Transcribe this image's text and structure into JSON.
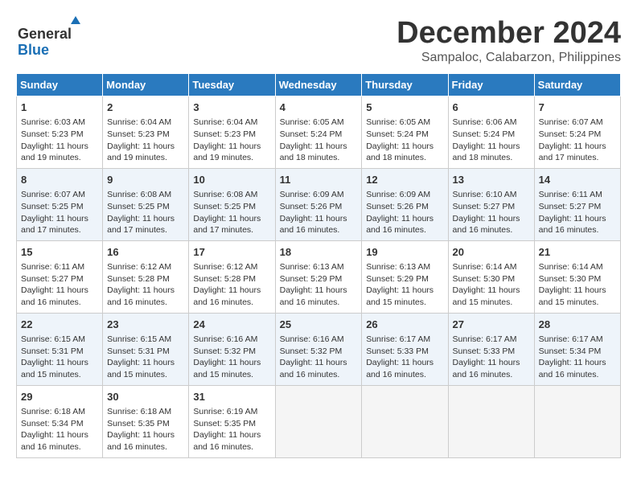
{
  "header": {
    "logo_general": "General",
    "logo_blue": "Blue",
    "title": "December 2024",
    "subtitle": "Sampaloc, Calabarzon, Philippines"
  },
  "days_of_week": [
    "Sunday",
    "Monday",
    "Tuesday",
    "Wednesday",
    "Thursday",
    "Friday",
    "Saturday"
  ],
  "weeks": [
    [
      {
        "day": "1",
        "sunrise": "Sunrise: 6:03 AM",
        "sunset": "Sunset: 5:23 PM",
        "daylight": "Daylight: 11 hours and 19 minutes."
      },
      {
        "day": "2",
        "sunrise": "Sunrise: 6:04 AM",
        "sunset": "Sunset: 5:23 PM",
        "daylight": "Daylight: 11 hours and 19 minutes."
      },
      {
        "day": "3",
        "sunrise": "Sunrise: 6:04 AM",
        "sunset": "Sunset: 5:23 PM",
        "daylight": "Daylight: 11 hours and 19 minutes."
      },
      {
        "day": "4",
        "sunrise": "Sunrise: 6:05 AM",
        "sunset": "Sunset: 5:24 PM",
        "daylight": "Daylight: 11 hours and 18 minutes."
      },
      {
        "day": "5",
        "sunrise": "Sunrise: 6:05 AM",
        "sunset": "Sunset: 5:24 PM",
        "daylight": "Daylight: 11 hours and 18 minutes."
      },
      {
        "day": "6",
        "sunrise": "Sunrise: 6:06 AM",
        "sunset": "Sunset: 5:24 PM",
        "daylight": "Daylight: 11 hours and 18 minutes."
      },
      {
        "day": "7",
        "sunrise": "Sunrise: 6:07 AM",
        "sunset": "Sunset: 5:24 PM",
        "daylight": "Daylight: 11 hours and 17 minutes."
      }
    ],
    [
      {
        "day": "8",
        "sunrise": "Sunrise: 6:07 AM",
        "sunset": "Sunset: 5:25 PM",
        "daylight": "Daylight: 11 hours and 17 minutes."
      },
      {
        "day": "9",
        "sunrise": "Sunrise: 6:08 AM",
        "sunset": "Sunset: 5:25 PM",
        "daylight": "Daylight: 11 hours and 17 minutes."
      },
      {
        "day": "10",
        "sunrise": "Sunrise: 6:08 AM",
        "sunset": "Sunset: 5:25 PM",
        "daylight": "Daylight: 11 hours and 17 minutes."
      },
      {
        "day": "11",
        "sunrise": "Sunrise: 6:09 AM",
        "sunset": "Sunset: 5:26 PM",
        "daylight": "Daylight: 11 hours and 16 minutes."
      },
      {
        "day": "12",
        "sunrise": "Sunrise: 6:09 AM",
        "sunset": "Sunset: 5:26 PM",
        "daylight": "Daylight: 11 hours and 16 minutes."
      },
      {
        "day": "13",
        "sunrise": "Sunrise: 6:10 AM",
        "sunset": "Sunset: 5:27 PM",
        "daylight": "Daylight: 11 hours and 16 minutes."
      },
      {
        "day": "14",
        "sunrise": "Sunrise: 6:11 AM",
        "sunset": "Sunset: 5:27 PM",
        "daylight": "Daylight: 11 hours and 16 minutes."
      }
    ],
    [
      {
        "day": "15",
        "sunrise": "Sunrise: 6:11 AM",
        "sunset": "Sunset: 5:27 PM",
        "daylight": "Daylight: 11 hours and 16 minutes."
      },
      {
        "day": "16",
        "sunrise": "Sunrise: 6:12 AM",
        "sunset": "Sunset: 5:28 PM",
        "daylight": "Daylight: 11 hours and 16 minutes."
      },
      {
        "day": "17",
        "sunrise": "Sunrise: 6:12 AM",
        "sunset": "Sunset: 5:28 PM",
        "daylight": "Daylight: 11 hours and 16 minutes."
      },
      {
        "day": "18",
        "sunrise": "Sunrise: 6:13 AM",
        "sunset": "Sunset: 5:29 PM",
        "daylight": "Daylight: 11 hours and 16 minutes."
      },
      {
        "day": "19",
        "sunrise": "Sunrise: 6:13 AM",
        "sunset": "Sunset: 5:29 PM",
        "daylight": "Daylight: 11 hours and 15 minutes."
      },
      {
        "day": "20",
        "sunrise": "Sunrise: 6:14 AM",
        "sunset": "Sunset: 5:30 PM",
        "daylight": "Daylight: 11 hours and 15 minutes."
      },
      {
        "day": "21",
        "sunrise": "Sunrise: 6:14 AM",
        "sunset": "Sunset: 5:30 PM",
        "daylight": "Daylight: 11 hours and 15 minutes."
      }
    ],
    [
      {
        "day": "22",
        "sunrise": "Sunrise: 6:15 AM",
        "sunset": "Sunset: 5:31 PM",
        "daylight": "Daylight: 11 hours and 15 minutes."
      },
      {
        "day": "23",
        "sunrise": "Sunrise: 6:15 AM",
        "sunset": "Sunset: 5:31 PM",
        "daylight": "Daylight: 11 hours and 15 minutes."
      },
      {
        "day": "24",
        "sunrise": "Sunrise: 6:16 AM",
        "sunset": "Sunset: 5:32 PM",
        "daylight": "Daylight: 11 hours and 15 minutes."
      },
      {
        "day": "25",
        "sunrise": "Sunrise: 6:16 AM",
        "sunset": "Sunset: 5:32 PM",
        "daylight": "Daylight: 11 hours and 16 minutes."
      },
      {
        "day": "26",
        "sunrise": "Sunrise: 6:17 AM",
        "sunset": "Sunset: 5:33 PM",
        "daylight": "Daylight: 11 hours and 16 minutes."
      },
      {
        "day": "27",
        "sunrise": "Sunrise: 6:17 AM",
        "sunset": "Sunset: 5:33 PM",
        "daylight": "Daylight: 11 hours and 16 minutes."
      },
      {
        "day": "28",
        "sunrise": "Sunrise: 6:17 AM",
        "sunset": "Sunset: 5:34 PM",
        "daylight": "Daylight: 11 hours and 16 minutes."
      }
    ],
    [
      {
        "day": "29",
        "sunrise": "Sunrise: 6:18 AM",
        "sunset": "Sunset: 5:34 PM",
        "daylight": "Daylight: 11 hours and 16 minutes."
      },
      {
        "day": "30",
        "sunrise": "Sunrise: 6:18 AM",
        "sunset": "Sunset: 5:35 PM",
        "daylight": "Daylight: 11 hours and 16 minutes."
      },
      {
        "day": "31",
        "sunrise": "Sunrise: 6:19 AM",
        "sunset": "Sunset: 5:35 PM",
        "daylight": "Daylight: 11 hours and 16 minutes."
      },
      null,
      null,
      null,
      null
    ]
  ]
}
